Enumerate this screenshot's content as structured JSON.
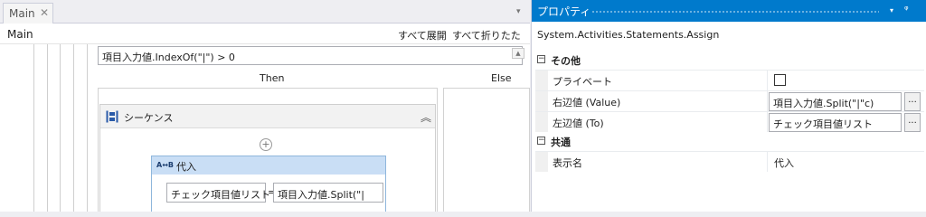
{
  "designer": {
    "tab": {
      "label": "Main",
      "close": "✕"
    },
    "tab_dropdown": "▾",
    "breadcrumb": "Main",
    "toolbar": {
      "expand_all": "すべて展開",
      "collapse_all": "すべて折りたたみ"
    },
    "if_activity": {
      "condition": "項目入力値.IndexOf(\"|\") > 0",
      "scroll_glyph": "▲",
      "then_label": "Then",
      "else_label": "Else"
    },
    "sequence": {
      "title": "シーケンス",
      "collapse_glyph": "︽",
      "add_glyph": "+"
    },
    "assign": {
      "icon_text": "A↔B",
      "title": "代入",
      "to": "チェック項目値リスト",
      "equals": "=",
      "value": "項目入力値.Split(\"|"
    }
  },
  "properties": {
    "title": "プロパティ",
    "dropdown": "▾",
    "pin": "ᵠ",
    "type_name": "System.Activities.Statements.Assign",
    "categories": [
      {
        "toggle": "−",
        "label": "その他",
        "rows": [
          {
            "name": "プライベート",
            "kind": "checkbox",
            "checked": false
          },
          {
            "name": "右辺値 (Value)",
            "value": "項目入力値.Split(\"|\"c)",
            "button": "..."
          },
          {
            "name": "左辺値 (To)",
            "value": "チェック項目値リスト",
            "button": "..."
          }
        ]
      },
      {
        "toggle": "−",
        "label": "共通",
        "rows": [
          {
            "name": "表示名",
            "value": "代入"
          }
        ]
      }
    ]
  },
  "colors": {
    "accent": "#007acc",
    "assign_header": "#c9def5",
    "assign_border": "#8fb7dc"
  }
}
